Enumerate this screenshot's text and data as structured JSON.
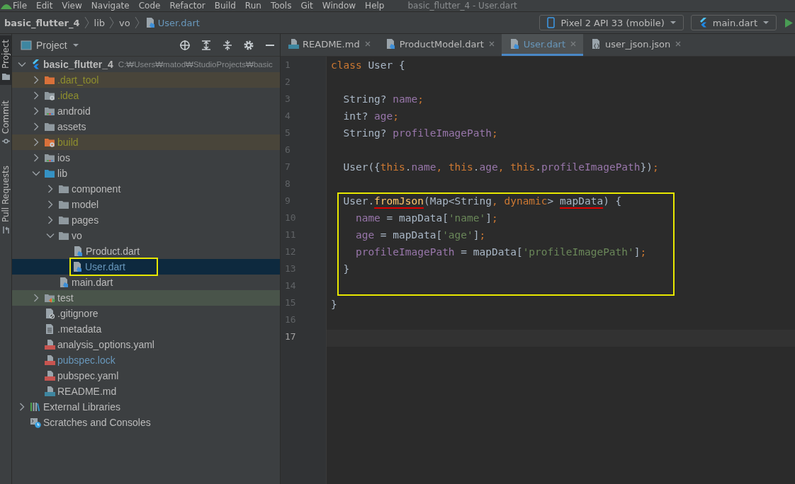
{
  "menu_bar": {
    "items": [
      "File",
      "Edit",
      "View",
      "Navigate",
      "Code",
      "Refactor",
      "Build",
      "Run",
      "Tools",
      "Git",
      "Window",
      "Help"
    ],
    "title": "basic_flutter_4 - User.dart"
  },
  "breadcrumbs": [
    {
      "label": "basic_flutter_4",
      "kind": "project",
      "modified": false
    },
    {
      "label": "lib",
      "kind": "folder",
      "modified": false
    },
    {
      "label": "vo",
      "kind": "folder",
      "modified": false
    },
    {
      "label": "User.dart",
      "kind": "dart-file",
      "modified": true
    }
  ],
  "run_toolbar": {
    "device": "Pixel 2 API 33 (mobile)",
    "configuration": "main.dart"
  },
  "tool_strip": [
    {
      "label": "Project",
      "kind": "project",
      "selected": true
    },
    {
      "label": "Commit",
      "kind": "commit",
      "selected": false
    },
    {
      "label": "Pull Requests",
      "kind": "pull-requests",
      "selected": false
    }
  ],
  "project_panel": {
    "view": "Project",
    "tree": [
      {
        "label": "basic_flutter_4",
        "path": "C:₩Users₩matod₩StudioProjects₩basic",
        "kind": "flutter",
        "expanded": true,
        "selected": false,
        "children": [
          {
            "label": ".dart_tool",
            "kind": "folder-excluded",
            "expanded": false,
            "selected": false,
            "ignored": true,
            "excluded": true
          },
          {
            "label": ".idea",
            "kind": "folder-config",
            "expanded": false,
            "selected": false,
            "ignored": true
          },
          {
            "label": "android",
            "kind": "folder-module",
            "expanded": false,
            "selected": false
          },
          {
            "label": "assets",
            "kind": "folder",
            "expanded": false,
            "selected": false
          },
          {
            "label": "build",
            "kind": "folder-excluded-config",
            "expanded": false,
            "selected": false,
            "ignored": true,
            "excluded": true
          },
          {
            "label": "ios",
            "kind": "folder-module",
            "expanded": false,
            "selected": false
          },
          {
            "label": "lib",
            "kind": "folder-source",
            "expanded": true,
            "selected": false,
            "children": [
              {
                "label": "component",
                "kind": "folder",
                "expanded": false,
                "selected": false
              },
              {
                "label": "model",
                "kind": "folder",
                "expanded": false,
                "selected": false
              },
              {
                "label": "pages",
                "kind": "folder",
                "expanded": false,
                "selected": false
              },
              {
                "label": "vo",
                "kind": "folder",
                "expanded": true,
                "selected": false,
                "children": [
                  {
                    "label": "Product.dart",
                    "kind": "dart-file",
                    "selected": false
                  },
                  {
                    "label": "User.dart",
                    "kind": "dart-file",
                    "selected": true,
                    "modified": true,
                    "highlighted": true
                  }
                ]
              },
              {
                "label": "main.dart",
                "kind": "dart-file",
                "selected": false
              }
            ]
          },
          {
            "label": "test",
            "kind": "folder-test",
            "expanded": false,
            "selected": false
          },
          {
            "label": ".gitignore",
            "kind": "ignore-file",
            "selected": false
          },
          {
            "label": ".metadata",
            "kind": "text-file",
            "selected": false
          },
          {
            "label": "analysis_options.yaml",
            "kind": "yaml-file",
            "selected": false
          },
          {
            "label": "pubspec.lock",
            "kind": "yaml-file",
            "selected": false,
            "modified": true
          },
          {
            "label": "pubspec.yaml",
            "kind": "yaml-file",
            "selected": false
          },
          {
            "label": "README.md",
            "kind": "md-file",
            "selected": false
          }
        ]
      },
      {
        "label": "External Libraries",
        "kind": "libraries",
        "expanded": false,
        "selected": false
      },
      {
        "label": "Scratches and Consoles",
        "kind": "scratches",
        "selected": false
      }
    ]
  },
  "editor": {
    "tabs": [
      {
        "label": "README.md",
        "kind": "md-file",
        "selected": false,
        "modified": false
      },
      {
        "label": "ProductModel.dart",
        "kind": "dart-file",
        "selected": false,
        "modified": false
      },
      {
        "label": "User.dart",
        "kind": "dart-file",
        "selected": true,
        "modified": true
      },
      {
        "label": "user_json.json",
        "kind": "json-file",
        "selected": false,
        "modified": false
      }
    ],
    "lines": [
      {
        "number": "1",
        "tokens": [
          {
            "text": "class",
            "kind": "keyword"
          },
          {
            "text": " User {",
            "kind": "plain"
          }
        ]
      },
      {
        "number": "2"
      },
      {
        "number": "3",
        "tokens": [
          {
            "text": "  String? ",
            "kind": "plain"
          },
          {
            "text": "name",
            "kind": "field"
          },
          {
            "text": ";",
            "kind": "keyword"
          }
        ]
      },
      {
        "number": "4",
        "tokens": [
          {
            "text": "  int? ",
            "kind": "plain"
          },
          {
            "text": "age",
            "kind": "field"
          },
          {
            "text": ";",
            "kind": "keyword"
          }
        ]
      },
      {
        "number": "5",
        "tokens": [
          {
            "text": "  String? ",
            "kind": "plain"
          },
          {
            "text": "profileImagePath",
            "kind": "field"
          },
          {
            "text": ";",
            "kind": "keyword"
          }
        ]
      },
      {
        "number": "6"
      },
      {
        "number": "7",
        "tokens": [
          {
            "text": "  User({",
            "kind": "plain"
          },
          {
            "text": "this",
            "kind": "keyword"
          },
          {
            "text": ".",
            "kind": "plain"
          },
          {
            "text": "name",
            "kind": "field"
          },
          {
            "text": ", ",
            "kind": "keyword"
          },
          {
            "text": "this",
            "kind": "keyword"
          },
          {
            "text": ".",
            "kind": "plain"
          },
          {
            "text": "age",
            "kind": "field"
          },
          {
            "text": ", ",
            "kind": "keyword"
          },
          {
            "text": "this",
            "kind": "keyword"
          },
          {
            "text": ".",
            "kind": "plain"
          },
          {
            "text": "profileImagePath",
            "kind": "field"
          },
          {
            "text": "})",
            "kind": "plain"
          },
          {
            "text": ";",
            "kind": "keyword"
          }
        ]
      },
      {
        "number": "8"
      },
      {
        "kind": "annotation-box",
        "lines": [
          {
            "number": "9",
            "tokens": [
              {
                "text": "  User.",
                "kind": "plain"
              },
              {
                "text": "fromJson",
                "kind": "function",
                "underlined": true
              },
              {
                "text": "(Map<String",
                "kind": "plain"
              },
              {
                "text": ", ",
                "kind": "keyword"
              },
              {
                "text": "dynamic",
                "kind": "keyword"
              },
              {
                "text": "> ",
                "kind": "plain"
              },
              {
                "text": "mapData",
                "kind": "plain",
                "underlined": true
              },
              {
                "text": ") {",
                "kind": "plain"
              }
            ]
          },
          {
            "number": "10",
            "tokens": [
              {
                "text": "    name",
                "kind": "field"
              },
              {
                "text": " = mapData[",
                "kind": "plain"
              },
              {
                "text": "'name'",
                "kind": "string"
              },
              {
                "text": "]",
                "kind": "plain"
              },
              {
                "text": ";",
                "kind": "keyword"
              }
            ]
          },
          {
            "number": "11",
            "tokens": [
              {
                "text": "    age",
                "kind": "field"
              },
              {
                "text": " = mapData[",
                "kind": "plain"
              },
              {
                "text": "'age'",
                "kind": "string"
              },
              {
                "text": "]",
                "kind": "plain"
              },
              {
                "text": ";",
                "kind": "keyword"
              }
            ]
          },
          {
            "number": "12",
            "tokens": [
              {
                "text": "    profileImagePath",
                "kind": "field"
              },
              {
                "text": " = mapData[",
                "kind": "plain"
              },
              {
                "text": "'profileImagePath'",
                "kind": "string"
              },
              {
                "text": "]",
                "kind": "plain"
              },
              {
                "text": ";",
                "kind": "keyword"
              }
            ]
          },
          {
            "number": "13",
            "tokens": [
              {
                "text": "  }",
                "kind": "plain"
              }
            ]
          },
          {
            "number": "14"
          }
        ]
      },
      {
        "number": "15",
        "tokens": [
          {
            "text": "}",
            "kind": "plain"
          }
        ]
      },
      {
        "number": "16"
      },
      {
        "number": "17",
        "current": true
      }
    ]
  }
}
